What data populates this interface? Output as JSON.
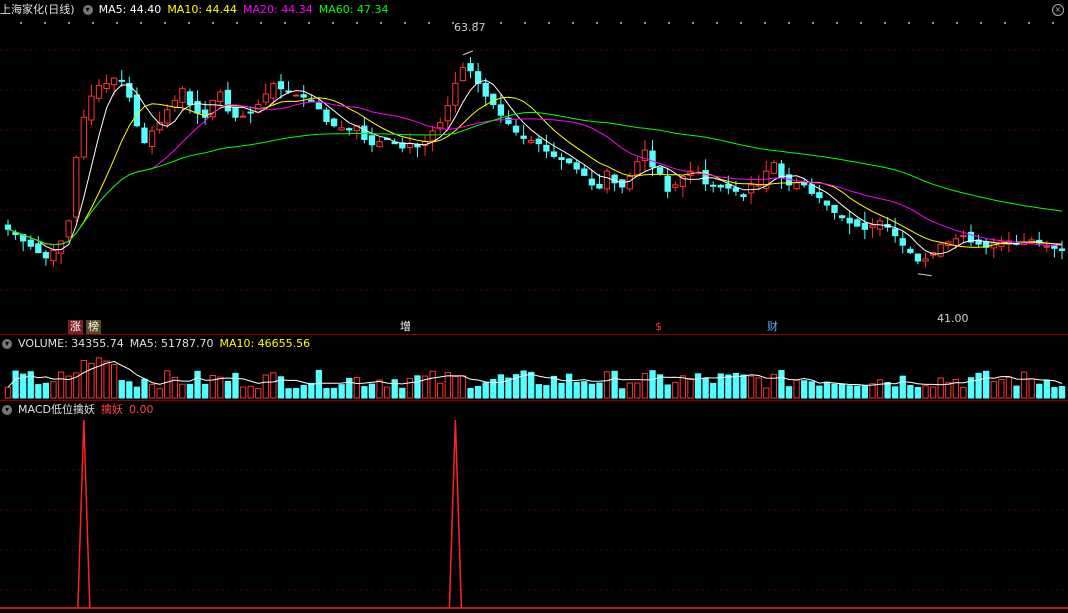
{
  "header": {
    "title": "上海家化(日线)",
    "ma": [
      {
        "label": "MA5: 44.40",
        "color": "#ffffff"
      },
      {
        "label": "MA10: 44.44",
        "color": "#ffff00"
      },
      {
        "label": "MA20: 44.34",
        "color": "#ff00ff"
      },
      {
        "label": "MA60: 47.34",
        "color": "#00ff00"
      }
    ]
  },
  "price": {
    "high_label": "63.87",
    "low_label": "41.00",
    "ylim": [
      38,
      66
    ]
  },
  "events": [
    {
      "text": "涨",
      "bg": "#7a2020",
      "color": "#ffffff"
    },
    {
      "text": "榜",
      "bg": "#5a4a20",
      "color": "#ffffff"
    },
    {
      "text": "增",
      "bg": "#000000",
      "color": "#ffffff"
    },
    {
      "text": "$",
      "bg": "#000000",
      "color": "#ff3333"
    },
    {
      "text": "财",
      "bg": "#000000",
      "color": "#66aaff"
    }
  ],
  "volume": {
    "label": "VOLUME: 34355.74",
    "ma5": "MA5: 51787.70",
    "ma10": "MA10: 46655.56"
  },
  "macd": {
    "label": "MACD低位擒妖",
    "sub": "擒妖",
    "value": "0.00"
  },
  "colors": {
    "up": "#ff3333",
    "down": "#55ffff",
    "ma5": "#ffffff",
    "ma10": "#ffff00",
    "ma20": "#ff00ff",
    "ma60": "#00ff00",
    "signal": "#ff2222"
  },
  "chart_data": {
    "type": "candlestick",
    "closes": [
      46.2,
      45.7,
      45.1,
      44.6,
      44.0,
      43.5,
      44.2,
      45.1,
      47.0,
      53.0,
      56.8,
      58.8,
      59.8,
      60.0,
      60.5,
      60.2,
      58.7,
      56.0,
      54.4,
      55.5,
      56.3,
      57.5,
      58.4,
      59.5,
      58.0,
      57.2,
      56.8,
      58.4,
      59.2,
      57.4,
      56.8,
      56.9,
      57.2,
      58.0,
      59.0,
      60.0,
      59.5,
      59.2,
      58.9,
      58.7,
      58.3,
      57.6,
      56.4,
      56.0,
      55.8,
      55.6,
      56.0,
      54.7,
      54.2,
      54.5,
      54.7,
      54.3,
      53.9,
      54.3,
      54.0,
      54.5,
      55.5,
      56.3,
      57.9,
      60.0,
      61.5,
      61.2,
      60.0,
      58.8,
      58.0,
      57.0,
      56.2,
      55.4,
      54.8,
      54.6,
      54.3,
      53.6,
      53.1,
      52.8,
      52.5,
      51.9,
      51.3,
      50.4,
      50.1,
      51.7,
      50.6,
      50.2,
      51.2,
      52.6,
      53.7,
      52.1,
      51.5,
      49.8,
      50.4,
      51.2,
      51.7,
      51.6,
      50.5,
      50.3,
      50.2,
      50.1,
      49.8,
      49.3,
      50.4,
      50.4,
      51.7,
      52.5,
      51.1,
      50.4,
      50.6,
      50.4,
      49.6,
      49.2,
      48.5,
      47.8,
      47.3,
      46.8,
      46.5,
      46.2,
      46.6,
      47.0,
      46.4,
      45.6,
      44.7,
      44.0,
      43.2,
      43.4,
      44.0,
      44.8,
      45.0,
      45.3,
      45.6,
      45.0,
      44.8,
      44.5,
      44.9,
      45.0,
      45.1,
      44.8,
      45.0,
      45.2,
      44.9,
      44.6,
      44.4,
      44.2
    ]
  }
}
